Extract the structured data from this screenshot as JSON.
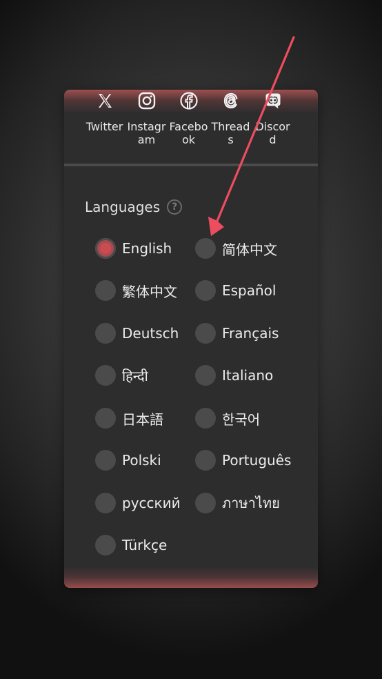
{
  "social": {
    "items": [
      {
        "label": "Twitter",
        "icon": "x-logo-icon"
      },
      {
        "label": "Instagram",
        "icon": "instagram-icon"
      },
      {
        "label": "Facebook",
        "icon": "facebook-icon"
      },
      {
        "label": "Threads",
        "icon": "threads-icon"
      },
      {
        "label": "Discord",
        "icon": "discord-icon"
      }
    ]
  },
  "languages": {
    "title": "Languages",
    "help_glyph": "?",
    "selected": "English",
    "options": [
      {
        "label": "English",
        "selected": true
      },
      {
        "label": "简体中文",
        "selected": false
      },
      {
        "label": "繁体中文",
        "selected": false
      },
      {
        "label": "Español",
        "selected": false
      },
      {
        "label": "Deutsch",
        "selected": false
      },
      {
        "label": "Français",
        "selected": false
      },
      {
        "label": "हिन्दी",
        "selected": false
      },
      {
        "label": "Italiano",
        "selected": false
      },
      {
        "label": "日本語",
        "selected": false
      },
      {
        "label": "한국어",
        "selected": false
      },
      {
        "label": "Polski",
        "selected": false
      },
      {
        "label": "Português",
        "selected": false
      },
      {
        "label": "русский",
        "selected": false
      },
      {
        "label": "ภาษาไทย",
        "selected": false
      },
      {
        "label": "Türkçe",
        "selected": false
      }
    ]
  },
  "colors": {
    "panel_bg": "#2e2d2e",
    "accent": "#c94c52",
    "radio_bg": "#4b4b4c",
    "annotation_arrow": "#ee4d5f"
  }
}
